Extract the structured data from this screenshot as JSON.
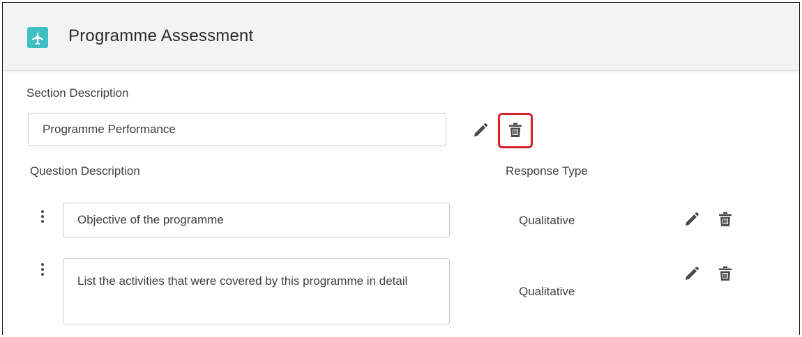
{
  "app": {
    "title": "Programme Assessment",
    "accent_color": "#3dbfc4",
    "logo_icon": "plane-icon"
  },
  "section": {
    "label": "Section Description",
    "value": "Programme Performance",
    "edit_icon": "pencil-icon",
    "delete_icon": "trash-icon",
    "delete_highlight_color": "#d6202a"
  },
  "questions_header": {
    "question_label": "Question Description",
    "response_label": "Response Type"
  },
  "questions": [
    {
      "description": "Objective of the programme",
      "response_type": "Qualitative"
    },
    {
      "description": "List the activities that were covered by this programme in detail",
      "response_type": "Qualitative"
    }
  ]
}
